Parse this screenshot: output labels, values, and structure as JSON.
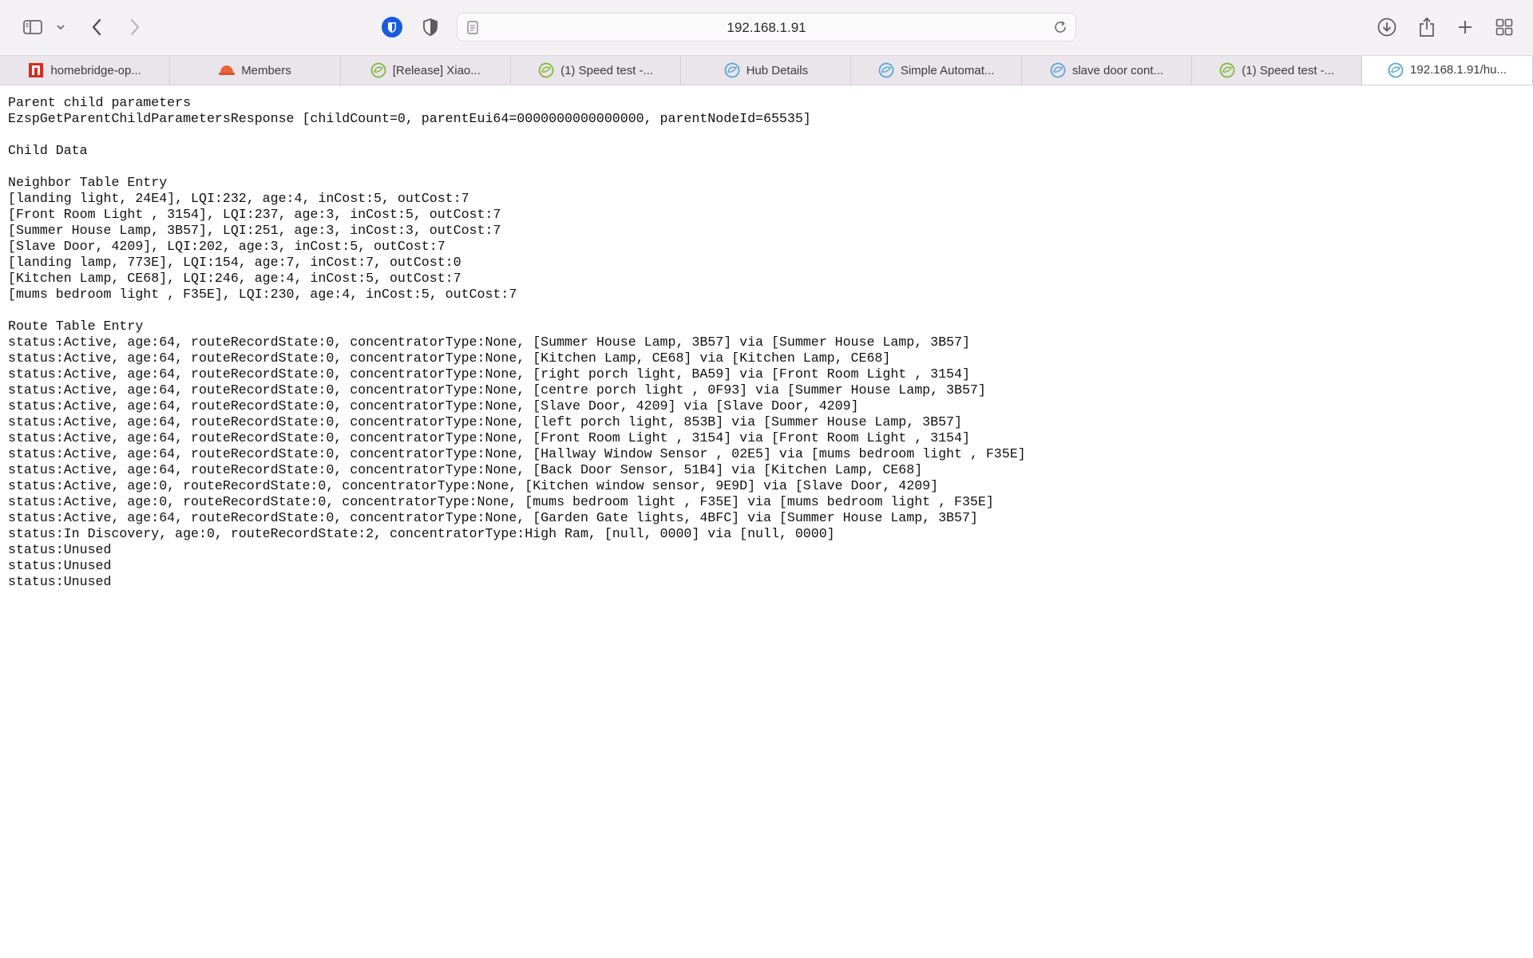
{
  "browser": {
    "url": "192.168.1.91",
    "tabs": [
      {
        "label": "homebridge-op...",
        "icon": "homebridge-icon"
      },
      {
        "label": "Members",
        "icon": "hard-hat-icon"
      },
      {
        "label": "[Release] Xiao...",
        "icon": "hubitat-community-icon"
      },
      {
        "label": "(1) Speed test -...",
        "icon": "hubitat-community-icon"
      },
      {
        "label": "Hub Details",
        "icon": "hubitat-icon"
      },
      {
        "label": "Simple Automat...",
        "icon": "hubitat-icon"
      },
      {
        "label": "slave door cont...",
        "icon": "hubitat-icon"
      },
      {
        "label": "(1) Speed test -...",
        "icon": "hubitat-community-icon"
      },
      {
        "label": "192.168.1.91/hu...",
        "icon": "hubitat-icon"
      }
    ],
    "active_tab": 8
  },
  "page": {
    "lines": [
      "Parent child parameters",
      "EzspGetParentChildParametersResponse [childCount=0, parentEui64=0000000000000000, parentNodeId=65535]",
      "",
      "Child Data",
      "",
      "Neighbor Table Entry",
      "[landing light, 24E4], LQI:232, age:4, inCost:5, outCost:7",
      "[Front Room Light , 3154], LQI:237, age:3, inCost:5, outCost:7",
      "[Summer House Lamp, 3B57], LQI:251, age:3, inCost:3, outCost:7",
      "[Slave Door, 4209], LQI:202, age:3, inCost:5, outCost:7",
      "[landing lamp, 773E], LQI:154, age:7, inCost:7, outCost:0",
      "[Kitchen Lamp, CE68], LQI:246, age:4, inCost:5, outCost:7",
      "[mums bedroom light , F35E], LQI:230, age:4, inCost:5, outCost:7",
      "",
      "Route Table Entry",
      "status:Active, age:64, routeRecordState:0, concentratorType:None, [Summer House Lamp, 3B57] via [Summer House Lamp, 3B57]",
      "status:Active, age:64, routeRecordState:0, concentratorType:None, [Kitchen Lamp, CE68] via [Kitchen Lamp, CE68]",
      "status:Active, age:64, routeRecordState:0, concentratorType:None, [right porch light, BA59] via [Front Room Light , 3154]",
      "status:Active, age:64, routeRecordState:0, concentratorType:None, [centre porch light , 0F93] via [Summer House Lamp, 3B57]",
      "status:Active, age:64, routeRecordState:0, concentratorType:None, [Slave Door, 4209] via [Slave Door, 4209]",
      "status:Active, age:64, routeRecordState:0, concentratorType:None, [left porch light, 853B] via [Summer House Lamp, 3B57]",
      "status:Active, age:64, routeRecordState:0, concentratorType:None, [Front Room Light , 3154] via [Front Room Light , 3154]",
      "status:Active, age:64, routeRecordState:0, concentratorType:None, [Hallway Window Sensor , 02E5] via [mums bedroom light , F35E]",
      "status:Active, age:64, routeRecordState:0, concentratorType:None, [Back Door Sensor, 51B4] via [Kitchen Lamp, CE68]",
      "status:Active, age:0, routeRecordState:0, concentratorType:None, [Kitchen window sensor, 9E9D] via [Slave Door, 4209]",
      "status:Active, age:0, routeRecordState:0, concentratorType:None, [mums bedroom light , F35E] via [mums bedroom light , F35E]",
      "status:Active, age:64, routeRecordState:0, concentratorType:None, [Garden Gate lights, 4BFC] via [Summer House Lamp, 3B57]",
      "status:In Discovery, age:0, routeRecordState:2, concentratorType:High Ram, [null, 0000] via [null, 0000]",
      "status:Unused",
      "status:Unused",
      "status:Unused"
    ]
  }
}
